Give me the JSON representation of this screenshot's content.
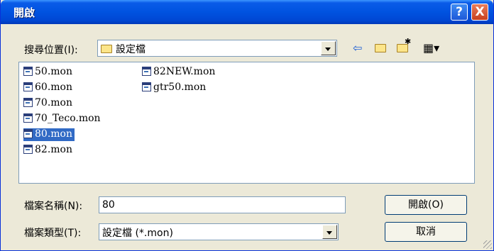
{
  "title_bar": {
    "title": "開啟",
    "help_label": "?",
    "close_label": "X"
  },
  "look_in": {
    "label": "搜尋位置(I):",
    "value": "設定檔",
    "value_icon": "folder-icon"
  },
  "toolbar": {
    "back": "⇦",
    "up": "⇧",
    "new_folder": "✱",
    "view": "▦▾"
  },
  "files": [
    {
      "name": "50.mon",
      "selected": false
    },
    {
      "name": "60.mon",
      "selected": false
    },
    {
      "name": "70.mon",
      "selected": false
    },
    {
      "name": "70_Teco.mon",
      "selected": false
    },
    {
      "name": "80.mon",
      "selected": true
    },
    {
      "name": "82.mon",
      "selected": false
    },
    {
      "name": "82NEW.mon",
      "selected": false
    },
    {
      "name": "gtr50.mon",
      "selected": false
    }
  ],
  "filename": {
    "label": "檔案名稱(N):",
    "value": "80"
  },
  "filetype": {
    "label": "檔案類型(T):",
    "value": "設定檔 (*.mon)"
  },
  "buttons": {
    "open": "開啟(O)",
    "cancel": "取消"
  },
  "colors": {
    "title_bar": "#0053e0",
    "selection": "#316ac5",
    "background": "#ece9d8"
  }
}
